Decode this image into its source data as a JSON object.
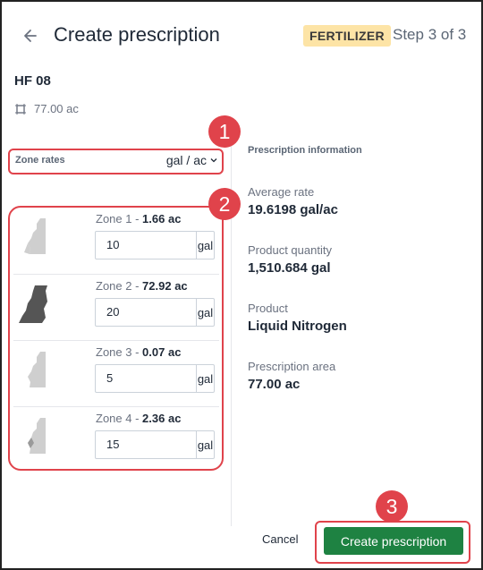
{
  "header": {
    "title": "Create prescription",
    "badge": "FERTILIZER",
    "step": "Step 3 of 3"
  },
  "field": {
    "name": "HF 08",
    "area": "77.00 ac"
  },
  "zone_rates": {
    "label": "Zone rates",
    "unit": "gal / ac"
  },
  "zones": [
    {
      "name": "Zone 1",
      "area": "1.66 ac",
      "value": "10",
      "unit": "gal"
    },
    {
      "name": "Zone 2",
      "area": "72.92 ac",
      "value": "20",
      "unit": "gal"
    },
    {
      "name": "Zone 3",
      "area": "0.07 ac",
      "value": "5",
      "unit": "gal"
    },
    {
      "name": "Zone 4",
      "area": "2.36 ac",
      "value": "15",
      "unit": "gal"
    }
  ],
  "info": {
    "heading": "Prescription information",
    "items": [
      {
        "label": "Average rate",
        "value": "19.6198 gal/ac"
      },
      {
        "label": "Product quantity",
        "value": "1,510.684 gal"
      },
      {
        "label": "Product",
        "value": "Liquid Nitrogen"
      },
      {
        "label": "Prescription area",
        "value": "77.00 ac"
      }
    ]
  },
  "footer": {
    "cancel": "Cancel",
    "create": "Create prescription"
  },
  "callouts": [
    "1",
    "2",
    "3"
  ],
  "colors": {
    "callout": "#e0434b",
    "primary_button": "#1e8242",
    "badge_bg": "#fde4a6"
  }
}
